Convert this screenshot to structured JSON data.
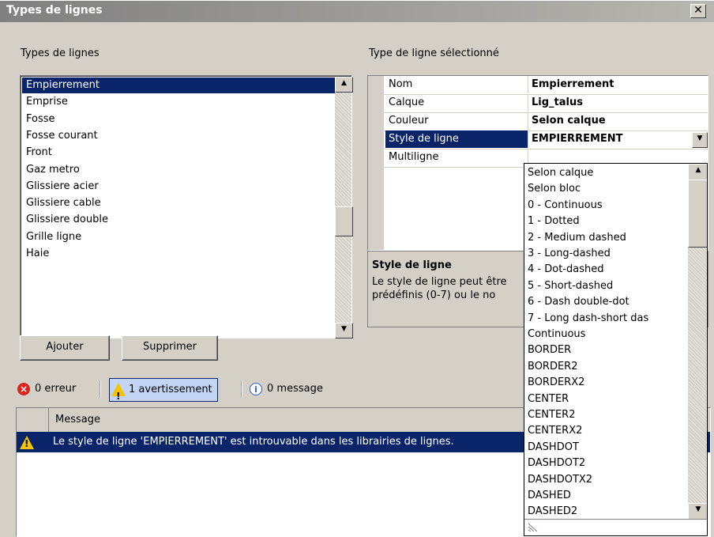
{
  "window": {
    "title": "Types de lignes",
    "close": "✕"
  },
  "left": {
    "label": "Types de lignes",
    "items": [
      "Empierrement",
      "Emprise",
      "Fosse",
      "Fosse courant",
      "Front",
      "Gaz metro",
      "Glissiere acier",
      "Glissiere cable",
      "Glissiere double",
      "Grille ligne",
      "Haie"
    ],
    "selected_index": 0,
    "add_button": "Ajouter",
    "delete_button": "Supprimer"
  },
  "right": {
    "label": "Type de ligne sélectionné",
    "properties": [
      {
        "name": "Nom",
        "value": "Empierrement"
      },
      {
        "name": "Calque",
        "value": "Lig_talus"
      },
      {
        "name": "Couleur",
        "value": "Selon calque"
      },
      {
        "name": "Style de ligne",
        "value": "EMPIERREMENT"
      },
      {
        "name": "Multiligne",
        "value": ""
      }
    ],
    "description_title": "Style de ligne",
    "description_line1": "Le style de ligne peut être",
    "description_line2": "prédéfinis (0-7) ou le no",
    "dropdown_items": [
      "Selon calque",
      "Selon bloc",
      "0 - Continuous",
      "1 - Dotted",
      "2 - Medium dashed",
      "3 - Long-dashed",
      "4 - Dot-dashed",
      "5 - Short-dashed",
      "6 - Dash double-dot",
      "7 - Long dash-short das",
      "Continuous",
      "BORDER",
      "BORDER2",
      "BORDERX2",
      "CENTER",
      "CENTER2",
      "CENTERX2",
      "DASHDOT",
      "DASHDOT2",
      "DASHDOTX2",
      "DASHED",
      "DASHED2"
    ]
  },
  "messages": {
    "errors": "0 erreur",
    "warnings": "1 avertissement",
    "info": "0 message",
    "column": "Message",
    "rows": [
      "Le style de ligne 'EMPIERREMENT' est introuvable dans les librairies de lignes."
    ]
  },
  "colors": {
    "selection": "#0a246a",
    "warning": "#f4c400",
    "error": "#dd2222"
  }
}
